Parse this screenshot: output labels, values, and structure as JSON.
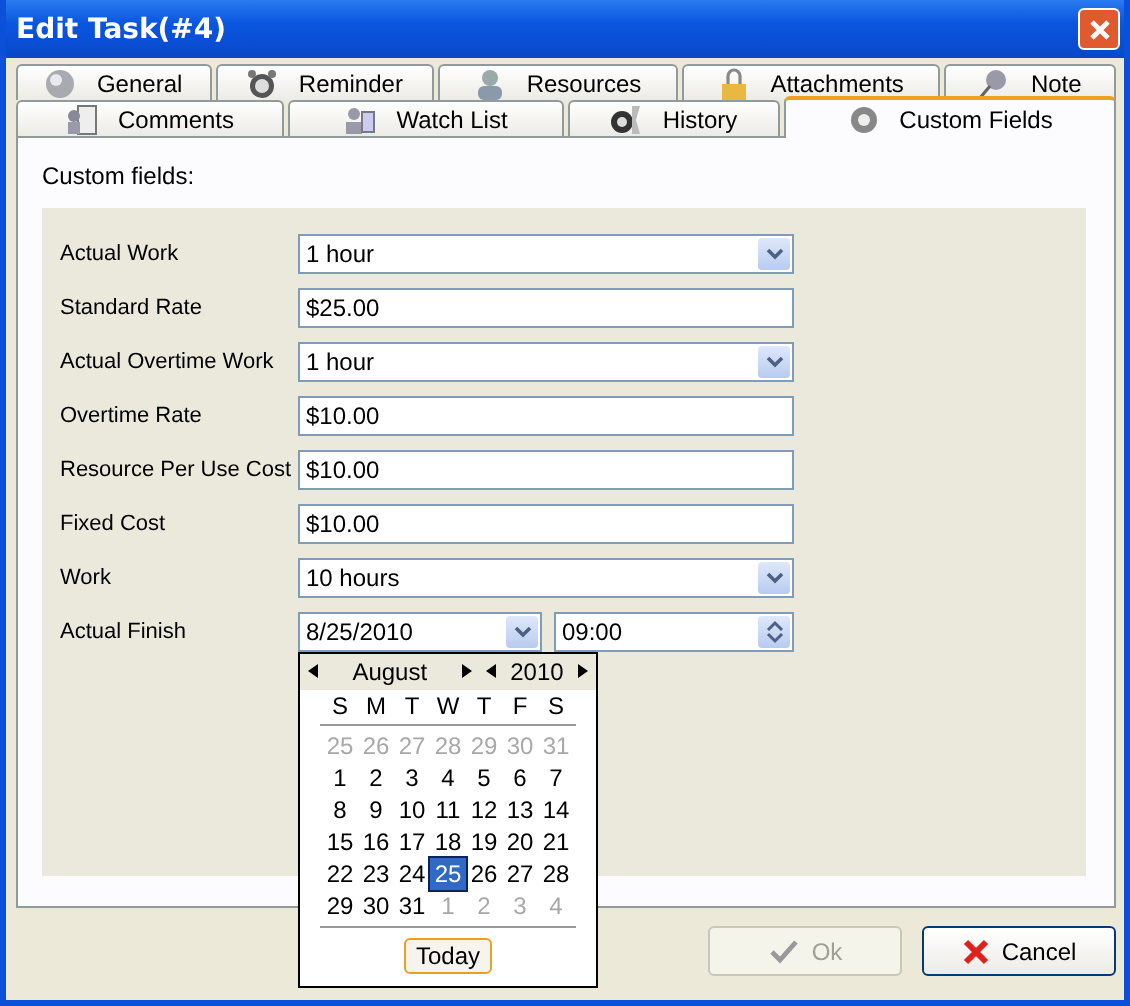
{
  "window": {
    "title": "Edit Task(#4)"
  },
  "tab_rows": [
    [
      {
        "label": "General",
        "selected": false
      },
      {
        "label": "Reminder",
        "selected": false
      },
      {
        "label": "Resources",
        "selected": false
      },
      {
        "label": "Attachments",
        "selected": false
      },
      {
        "label": "Note",
        "selected": false
      }
    ],
    [
      {
        "label": "Comments",
        "selected": false
      },
      {
        "label": "Watch List",
        "selected": false
      },
      {
        "label": "History",
        "selected": false
      },
      {
        "label": "Custom Fields",
        "selected": true
      }
    ]
  ],
  "section_label": "Custom fields:",
  "fields": [
    {
      "label": "Actual Work",
      "kind": "dropdown",
      "value": "1 hour"
    },
    {
      "label": "Standard Rate",
      "kind": "text",
      "value": "$25.00"
    },
    {
      "label": "Actual Overtime Work",
      "kind": "dropdown",
      "value": "1 hour"
    },
    {
      "label": "Overtime Rate",
      "kind": "text",
      "value": "$10.00"
    },
    {
      "label": "Resource Per Use Cost",
      "kind": "text",
      "value": "$10.00"
    },
    {
      "label": "Fixed Cost",
      "kind": "text",
      "value": "$10.00"
    },
    {
      "label": "Work",
      "kind": "dropdown",
      "value": "10 hours"
    },
    {
      "label": "Actual Finish",
      "kind": "datetime",
      "value": "8/25/2010",
      "time": "09:00"
    }
  ],
  "calendar": {
    "month": "August",
    "year": "2010",
    "weekdays": [
      "S",
      "M",
      "T",
      "W",
      "T",
      "F",
      "S"
    ],
    "weeks": [
      [
        {
          "day": "25",
          "muted": true,
          "selected": false
        },
        {
          "day": "26",
          "muted": true,
          "selected": false
        },
        {
          "day": "27",
          "muted": true,
          "selected": false
        },
        {
          "day": "28",
          "muted": true,
          "selected": false
        },
        {
          "day": "29",
          "muted": true,
          "selected": false
        },
        {
          "day": "30",
          "muted": true,
          "selected": false
        },
        {
          "day": "31",
          "muted": true,
          "selected": false
        }
      ],
      [
        {
          "day": "1",
          "muted": false,
          "selected": false
        },
        {
          "day": "2",
          "muted": false,
          "selected": false
        },
        {
          "day": "3",
          "muted": false,
          "selected": false
        },
        {
          "day": "4",
          "muted": false,
          "selected": false
        },
        {
          "day": "5",
          "muted": false,
          "selected": false
        },
        {
          "day": "6",
          "muted": false,
          "selected": false
        },
        {
          "day": "7",
          "muted": false,
          "selected": false
        }
      ],
      [
        {
          "day": "8",
          "muted": false,
          "selected": false
        },
        {
          "day": "9",
          "muted": false,
          "selected": false
        },
        {
          "day": "10",
          "muted": false,
          "selected": false
        },
        {
          "day": "11",
          "muted": false,
          "selected": false
        },
        {
          "day": "12",
          "muted": false,
          "selected": false
        },
        {
          "day": "13",
          "muted": false,
          "selected": false
        },
        {
          "day": "14",
          "muted": false,
          "selected": false
        }
      ],
      [
        {
          "day": "15",
          "muted": false,
          "selected": false
        },
        {
          "day": "16",
          "muted": false,
          "selected": false
        },
        {
          "day": "17",
          "muted": false,
          "selected": false
        },
        {
          "day": "18",
          "muted": false,
          "selected": false
        },
        {
          "day": "19",
          "muted": false,
          "selected": false
        },
        {
          "day": "20",
          "muted": false,
          "selected": false
        },
        {
          "day": "21",
          "muted": false,
          "selected": false
        }
      ],
      [
        {
          "day": "22",
          "muted": false,
          "selected": false
        },
        {
          "day": "23",
          "muted": false,
          "selected": false
        },
        {
          "day": "24",
          "muted": false,
          "selected": false
        },
        {
          "day": "25",
          "muted": false,
          "selected": true
        },
        {
          "day": "26",
          "muted": false,
          "selected": false
        },
        {
          "day": "27",
          "muted": false,
          "selected": false
        },
        {
          "day": "28",
          "muted": false,
          "selected": false
        }
      ],
      [
        {
          "day": "29",
          "muted": false,
          "selected": false
        },
        {
          "day": "30",
          "muted": false,
          "selected": false
        },
        {
          "day": "31",
          "muted": false,
          "selected": false
        },
        {
          "day": "1",
          "muted": true,
          "selected": false
        },
        {
          "day": "2",
          "muted": true,
          "selected": false
        },
        {
          "day": "3",
          "muted": true,
          "selected": false
        },
        {
          "day": "4",
          "muted": true,
          "selected": false
        }
      ]
    ],
    "today_button": "Today"
  },
  "buttons": [
    {
      "label": "Ok",
      "kind": "ok",
      "disabled": true
    },
    {
      "label": "Cancel",
      "kind": "cancel",
      "disabled": false
    }
  ]
}
